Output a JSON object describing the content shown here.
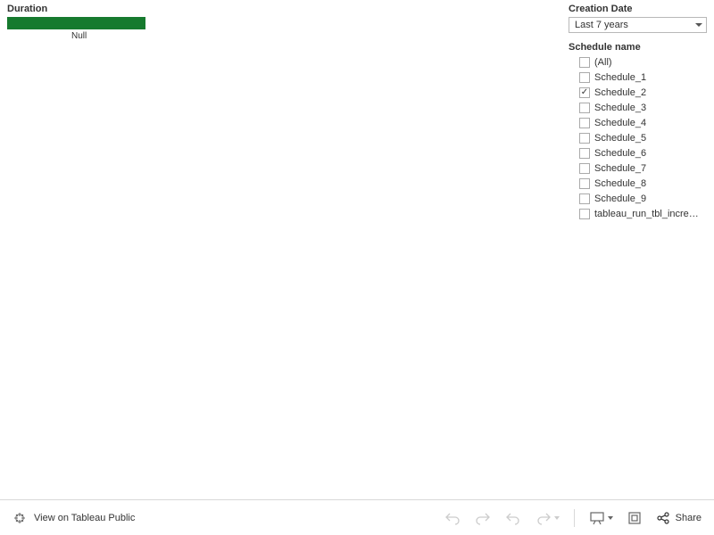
{
  "chart_data": {
    "type": "bar",
    "title": "Duration",
    "categories": [
      "Null"
    ],
    "values": [
      155
    ],
    "xlabel": "",
    "ylabel": "",
    "orientation": "horizontal"
  },
  "left": {
    "title": "Duration",
    "bar_label": "Null"
  },
  "right": {
    "creation_date_title": "Creation Date",
    "creation_date_value": "Last 7 years",
    "schedule_title": "Schedule name",
    "schedule_items": [
      {
        "label": "(All)",
        "checked": false
      },
      {
        "label": "Schedule_1",
        "checked": false
      },
      {
        "label": "Schedule_2",
        "checked": true
      },
      {
        "label": "Schedule_3",
        "checked": false
      },
      {
        "label": "Schedule_4",
        "checked": false
      },
      {
        "label": "Schedule_5",
        "checked": false
      },
      {
        "label": "Schedule_6",
        "checked": false
      },
      {
        "label": "Schedule_7",
        "checked": false
      },
      {
        "label": "Schedule_8",
        "checked": false
      },
      {
        "label": "Schedule_9",
        "checked": false
      },
      {
        "label": "tableau_run_tbl_incre…",
        "checked": false
      }
    ]
  },
  "toolbar": {
    "view_label": "View on Tableau Public",
    "share_label": "Share"
  }
}
